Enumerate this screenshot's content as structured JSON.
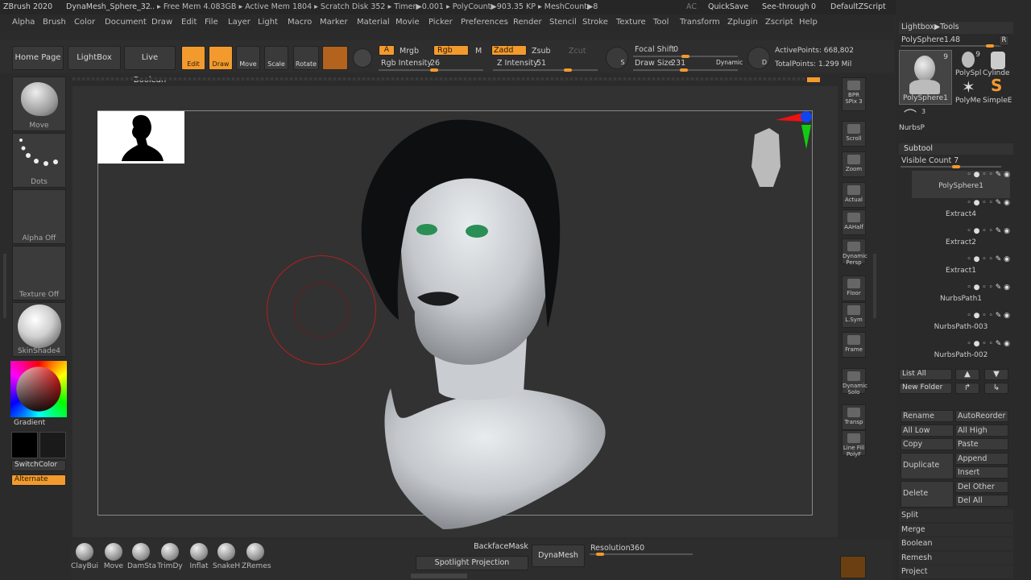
{
  "titlebar": {
    "app": "ZBrush 2020",
    "doc": "DynaMesh_Sphere_32",
    "stats": ".. ▸ Free Mem 4.083GB ▸ Active Mem 1804 ▸ Scratch Disk 352 ▸ Timer▶0.001 ▸ PolyCount▶903.35 KP ▸ MeshCount▶8",
    "ac": "AC",
    "quicksave": "QuickSave",
    "seethrough": "See-through",
    "seethrough_val": "0",
    "script": "DefaultZScript"
  },
  "menu": [
    "Alpha",
    "Brush",
    "Color",
    "Document",
    "Draw",
    "Edit",
    "File",
    "Layer",
    "Light",
    "Macro",
    "Marker",
    "Material",
    "Movie",
    "Picker",
    "Preferences",
    "Render",
    "Stencil",
    "Stroke",
    "Texture",
    "Tool",
    "Transform",
    "Zplugin",
    "Zscript",
    "Help"
  ],
  "shelf": {
    "home": "Home Page",
    "lightbox": "LightBox",
    "liveboolean": "Live Boolean",
    "edit": "Edit",
    "draw": "Draw",
    "move": "Move",
    "scale": "Scale",
    "rotate": "Rotate",
    "a": "A",
    "mrgb": "Mrgb",
    "rgb": "Rgb",
    "m": "M",
    "zadd": "Zadd",
    "zsub": "Zsub",
    "zcut": "Zcut",
    "rgb_intensity": "Rgb Intensity",
    "rgb_intensity_val": "26",
    "z_intensity": "Z Intensity",
    "z_intensity_val": "51",
    "focal": "Focal Shift",
    "focal_val": "0",
    "drawsize": "Draw Size",
    "drawsize_val": "231",
    "dynamic": "Dynamic",
    "s": "S",
    "d": "D",
    "activepoints": "ActivePoints: 668,802",
    "totalpoints": "TotalPoints: 1.299 Mil"
  },
  "left": {
    "move": "Move",
    "dots": "Dots",
    "alpha": "Alpha Off",
    "texture": "Texture Off",
    "material": "SkinShade4",
    "gradient": "Gradient",
    "switchcolor": "SwitchColor",
    "alternate": "Alternate"
  },
  "right_tools": [
    "BPR",
    "SPix 3",
    "Scroll",
    "Zoom",
    "Actual",
    "AAHalf",
    "Dynamic",
    "Persp",
    "Floor",
    "L.Sym",
    "Frame",
    "Dynamic",
    "Solo",
    "Transp",
    "Line Fill",
    "PolyF"
  ],
  "panel": {
    "lightbox_tools": "Lightbox▶Tools",
    "polysphere": "PolySphere1.",
    "polysphere_val": "48",
    "r": "R",
    "tools": [
      "PolySphere1",
      "PolySpl",
      "Cylinde",
      "PolyMe",
      "SimpleE",
      "NurbsP"
    ],
    "num9a": "9",
    "num9b": "9",
    "num3": "3",
    "subtool": "Subtool",
    "visible": "Visible Count 7",
    "subtools": [
      "PolySphere1",
      "Extract4",
      "Extract2",
      "Extract1",
      "NurbsPath1",
      "NurbsPath-003",
      "NurbsPath-002"
    ],
    "listall": "List All",
    "newfolder": "New Folder",
    "rename": "Rename",
    "autoreorder": "AutoReorder",
    "alllow": "All Low",
    "allhigh": "All High",
    "copy": "Copy",
    "paste": "Paste",
    "duplicate": "Duplicate",
    "append": "Append",
    "insert": "Insert",
    "delete": "Delete",
    "delother": "Del Other",
    "delall": "Del All",
    "split": "Split",
    "merge": "Merge",
    "boolean": "Boolean",
    "remesh": "Remesh",
    "project": "Project"
  },
  "bottom": {
    "brushes": [
      "ClayBui",
      "Move",
      "DamSta",
      "TrimDy",
      "Inflat",
      "SnakeH",
      "ZRemes"
    ],
    "backface": "BackfaceMask",
    "spotlight": "Spotlight Projection",
    "dynamesh": "DynaMesh",
    "resolution": "Resolution",
    "resolution_val": "360"
  },
  "colors": {
    "accent": "#f29a2e",
    "bg": "#2b2b2b"
  }
}
